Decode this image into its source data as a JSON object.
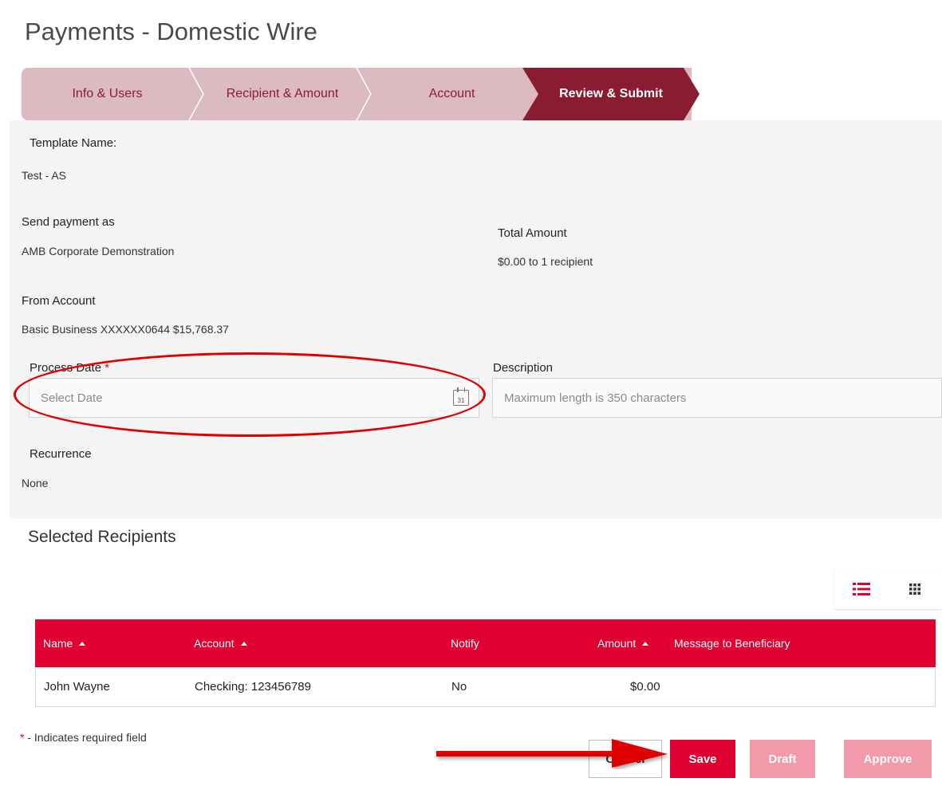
{
  "page": {
    "title": "Payments - Domestic Wire"
  },
  "stepper": {
    "steps": [
      {
        "label": "Info & Users"
      },
      {
        "label": "Recipient & Amount"
      },
      {
        "label": "Account"
      },
      {
        "label": "Review & Submit"
      }
    ],
    "active_index": 3
  },
  "summary": {
    "template_name_label": "Template Name:",
    "template_name_value": "Test - AS",
    "send_as_label": "Send payment as",
    "send_as_value": "AMB Corporate Demonstration",
    "total_amount_label": "Total Amount",
    "total_amount_value": "$0.00 to 1 recipient",
    "from_account_label": "From Account",
    "from_account_value": "Basic Business XXXXXX0644 $15,768.37",
    "process_date_label": "Process Date",
    "required_marker": "*",
    "process_date_placeholder": "Select Date",
    "calendar_day": "31",
    "description_label": "Description",
    "description_placeholder": "Maximum length is 350 characters",
    "recurrence_label": "Recurrence",
    "recurrence_value": "None"
  },
  "recipients": {
    "title": "Selected Recipients",
    "columns": [
      {
        "label": "Name"
      },
      {
        "label": "Account"
      },
      {
        "label": "Notify"
      },
      {
        "label": "Amount"
      },
      {
        "label": "Message to Beneficiary"
      }
    ],
    "rows": [
      {
        "name": "John Wayne",
        "account": "Checking: 123456789",
        "notify": "No",
        "amount": "$0.00",
        "message": ""
      }
    ]
  },
  "footer": {
    "required_marker": "*",
    "required_note": " - Indicates required field",
    "cancel_label": "Cancel",
    "save_label": "Save",
    "draft_label": "Draft",
    "approve_label": "Approve"
  },
  "colors": {
    "brand_red": "#de0132",
    "stepper_active": "#8a1c30",
    "stepper_inactive": "#dcbac2",
    "disabled_button": "#f29aaa",
    "annotation": "#e00000"
  }
}
